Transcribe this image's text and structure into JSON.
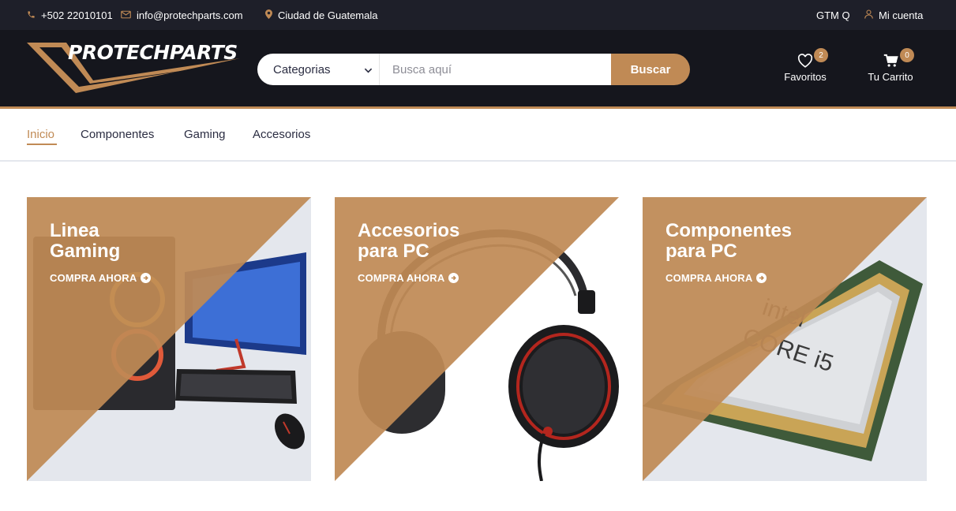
{
  "topbar": {
    "phone": "+502 22010101",
    "email": "info@protechparts.com",
    "location": "Ciudad de Guatemala",
    "currency": "GTM Q",
    "account": "Mi cuenta"
  },
  "header": {
    "logo_text": "PROTECHPARTS",
    "search": {
      "category_selected": "Categorias",
      "placeholder": "Busca aquí",
      "button_label": "Buscar"
    },
    "favorites": {
      "label": "Favoritos",
      "count": "2"
    },
    "cart": {
      "label": "Tu Carrito",
      "count": "0"
    }
  },
  "nav": {
    "items": [
      {
        "label": "Inicio"
      },
      {
        "label": "Componentes"
      },
      {
        "label": "Gaming"
      },
      {
        "label": "Accesorios"
      }
    ]
  },
  "collections": [
    {
      "title": "Linea\nGaming",
      "cta": "COMPRA AHORA"
    },
    {
      "title": "Accesorios\npara PC",
      "cta": "COMPRA AHORA"
    },
    {
      "title": "Componentes\npara PC",
      "cta": "COMPRA AHORA"
    }
  ],
  "colors": {
    "accent": "#c08a55",
    "header_bg": "#15161d",
    "topbar_bg": "#1e1f29",
    "card_bg": "#e4e7ed"
  },
  "icons": {
    "phone": "phone-icon",
    "email": "envelope-icon",
    "location": "map-marker-icon",
    "account": "user-icon",
    "favorites": "heart-icon",
    "cart": "shopping-cart-icon",
    "cta": "arrow-circle-right-icon"
  }
}
